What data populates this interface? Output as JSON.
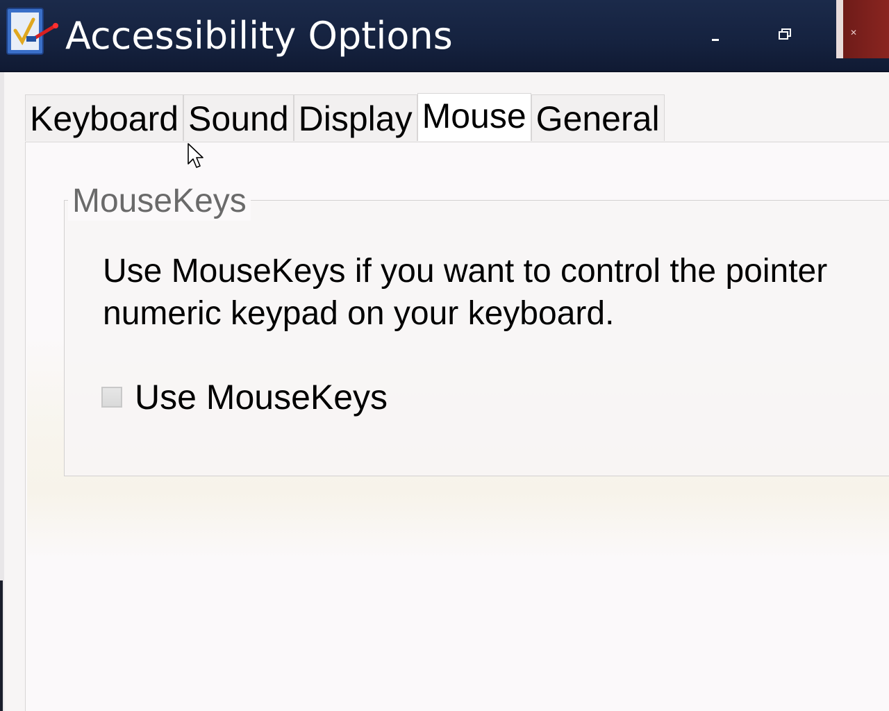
{
  "window": {
    "title": "Accessibility Options",
    "icon": "accessibility-options-icon",
    "minimize_icon": "minimize-icon",
    "restore_icon": "restore-icon",
    "close_icon": "close-icon",
    "close_glyph": "✕"
  },
  "tabs": [
    {
      "label": "Keyboard",
      "active": false
    },
    {
      "label": "Sound",
      "active": false
    },
    {
      "label": "Display",
      "active": false
    },
    {
      "label": "Mouse",
      "active": true
    },
    {
      "label": "General",
      "active": false
    }
  ],
  "mousekeys": {
    "group_label": "MouseKeys",
    "description": "Use MouseKeys if you want to control the pointer\nnumeric keypad on your keyboard.",
    "checkbox_label": "Use MouseKeys",
    "checked": false
  },
  "colors": {
    "titlebar": "#15223f",
    "close_button": "#8a2520",
    "panel": "#fbf9fa"
  }
}
